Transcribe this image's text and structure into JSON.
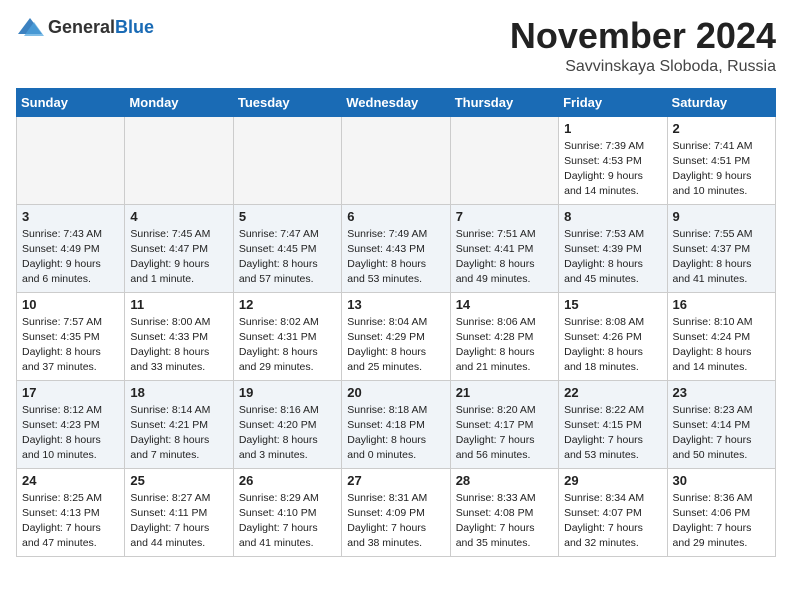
{
  "logo": {
    "general": "General",
    "blue": "Blue"
  },
  "title": {
    "month_year": "November 2024",
    "location": "Savvinskaya Sloboda, Russia"
  },
  "header": {
    "days": [
      "Sunday",
      "Monday",
      "Tuesday",
      "Wednesday",
      "Thursday",
      "Friday",
      "Saturday"
    ]
  },
  "weeks": [
    [
      {
        "day": "",
        "info": ""
      },
      {
        "day": "",
        "info": ""
      },
      {
        "day": "",
        "info": ""
      },
      {
        "day": "",
        "info": ""
      },
      {
        "day": "",
        "info": ""
      },
      {
        "day": "1",
        "info": "Sunrise: 7:39 AM\nSunset: 4:53 PM\nDaylight: 9 hours\nand 14 minutes."
      },
      {
        "day": "2",
        "info": "Sunrise: 7:41 AM\nSunset: 4:51 PM\nDaylight: 9 hours\nand 10 minutes."
      }
    ],
    [
      {
        "day": "3",
        "info": "Sunrise: 7:43 AM\nSunset: 4:49 PM\nDaylight: 9 hours\nand 6 minutes."
      },
      {
        "day": "4",
        "info": "Sunrise: 7:45 AM\nSunset: 4:47 PM\nDaylight: 9 hours\nand 1 minute."
      },
      {
        "day": "5",
        "info": "Sunrise: 7:47 AM\nSunset: 4:45 PM\nDaylight: 8 hours\nand 57 minutes."
      },
      {
        "day": "6",
        "info": "Sunrise: 7:49 AM\nSunset: 4:43 PM\nDaylight: 8 hours\nand 53 minutes."
      },
      {
        "day": "7",
        "info": "Sunrise: 7:51 AM\nSunset: 4:41 PM\nDaylight: 8 hours\nand 49 minutes."
      },
      {
        "day": "8",
        "info": "Sunrise: 7:53 AM\nSunset: 4:39 PM\nDaylight: 8 hours\nand 45 minutes."
      },
      {
        "day": "9",
        "info": "Sunrise: 7:55 AM\nSunset: 4:37 PM\nDaylight: 8 hours\nand 41 minutes."
      }
    ],
    [
      {
        "day": "10",
        "info": "Sunrise: 7:57 AM\nSunset: 4:35 PM\nDaylight: 8 hours\nand 37 minutes."
      },
      {
        "day": "11",
        "info": "Sunrise: 8:00 AM\nSunset: 4:33 PM\nDaylight: 8 hours\nand 33 minutes."
      },
      {
        "day": "12",
        "info": "Sunrise: 8:02 AM\nSunset: 4:31 PM\nDaylight: 8 hours\nand 29 minutes."
      },
      {
        "day": "13",
        "info": "Sunrise: 8:04 AM\nSunset: 4:29 PM\nDaylight: 8 hours\nand 25 minutes."
      },
      {
        "day": "14",
        "info": "Sunrise: 8:06 AM\nSunset: 4:28 PM\nDaylight: 8 hours\nand 21 minutes."
      },
      {
        "day": "15",
        "info": "Sunrise: 8:08 AM\nSunset: 4:26 PM\nDaylight: 8 hours\nand 18 minutes."
      },
      {
        "day": "16",
        "info": "Sunrise: 8:10 AM\nSunset: 4:24 PM\nDaylight: 8 hours\nand 14 minutes."
      }
    ],
    [
      {
        "day": "17",
        "info": "Sunrise: 8:12 AM\nSunset: 4:23 PM\nDaylight: 8 hours\nand 10 minutes."
      },
      {
        "day": "18",
        "info": "Sunrise: 8:14 AM\nSunset: 4:21 PM\nDaylight: 8 hours\nand 7 minutes."
      },
      {
        "day": "19",
        "info": "Sunrise: 8:16 AM\nSunset: 4:20 PM\nDaylight: 8 hours\nand 3 minutes."
      },
      {
        "day": "20",
        "info": "Sunrise: 8:18 AM\nSunset: 4:18 PM\nDaylight: 8 hours\nand 0 minutes."
      },
      {
        "day": "21",
        "info": "Sunrise: 8:20 AM\nSunset: 4:17 PM\nDaylight: 7 hours\nand 56 minutes."
      },
      {
        "day": "22",
        "info": "Sunrise: 8:22 AM\nSunset: 4:15 PM\nDaylight: 7 hours\nand 53 minutes."
      },
      {
        "day": "23",
        "info": "Sunrise: 8:23 AM\nSunset: 4:14 PM\nDaylight: 7 hours\nand 50 minutes."
      }
    ],
    [
      {
        "day": "24",
        "info": "Sunrise: 8:25 AM\nSunset: 4:13 PM\nDaylight: 7 hours\nand 47 minutes."
      },
      {
        "day": "25",
        "info": "Sunrise: 8:27 AM\nSunset: 4:11 PM\nDaylight: 7 hours\nand 44 minutes."
      },
      {
        "day": "26",
        "info": "Sunrise: 8:29 AM\nSunset: 4:10 PM\nDaylight: 7 hours\nand 41 minutes."
      },
      {
        "day": "27",
        "info": "Sunrise: 8:31 AM\nSunset: 4:09 PM\nDaylight: 7 hours\nand 38 minutes."
      },
      {
        "day": "28",
        "info": "Sunrise: 8:33 AM\nSunset: 4:08 PM\nDaylight: 7 hours\nand 35 minutes."
      },
      {
        "day": "29",
        "info": "Sunrise: 8:34 AM\nSunset: 4:07 PM\nDaylight: 7 hours\nand 32 minutes."
      },
      {
        "day": "30",
        "info": "Sunrise: 8:36 AM\nSunset: 4:06 PM\nDaylight: 7 hours\nand 29 minutes."
      }
    ]
  ]
}
